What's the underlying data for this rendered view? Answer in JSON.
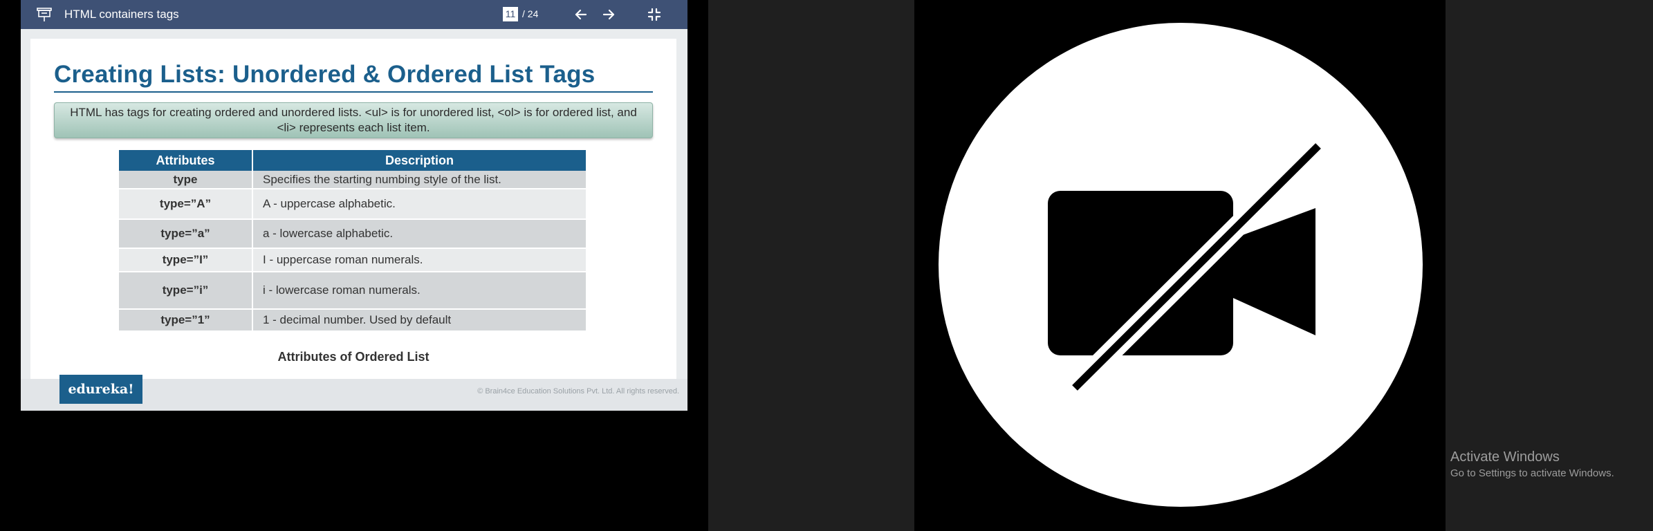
{
  "toolbar": {
    "presentation_icon": "presentation-screen-icon",
    "title": "HTML containers tags",
    "current_page": "11",
    "total_pages": "/ 24",
    "prev_icon": "arrow-left-icon",
    "next_icon": "arrow-right-icon",
    "exit_fullscreen_icon": "minimize-icon"
  },
  "slide": {
    "title": "Creating Lists: Unordered & Ordered List Tags",
    "intro": "HTML has tags for creating ordered and unordered lists. <ul> is for unordered list, <ol> is for ordered list, and <li> represents each list item.",
    "table": {
      "headers": [
        "Attributes",
        "Description"
      ],
      "rows": [
        [
          "type",
          "Specifies the starting numbing style of the list."
        ],
        [
          "type=”A”",
          "A - uppercase alphabetic."
        ],
        [
          "type=”a”",
          "a - lowercase alphabetic."
        ],
        [
          "type=”I”",
          "I - uppercase roman numerals."
        ],
        [
          "type=”i”",
          "i - lowercase roman numerals."
        ],
        [
          "type=”1”",
          "1 - decimal number. Used by default"
        ]
      ]
    },
    "caption": "Attributes of Ordered List",
    "brand": "edureka!",
    "copyright": "© Brain4ce Education Solutions Pvt. Ltd. All rights reserved."
  },
  "video": {
    "icon": "camera-off-icon"
  },
  "watermark": {
    "title": "Activate Windows",
    "subtitle": "Go to Settings to activate Windows."
  }
}
